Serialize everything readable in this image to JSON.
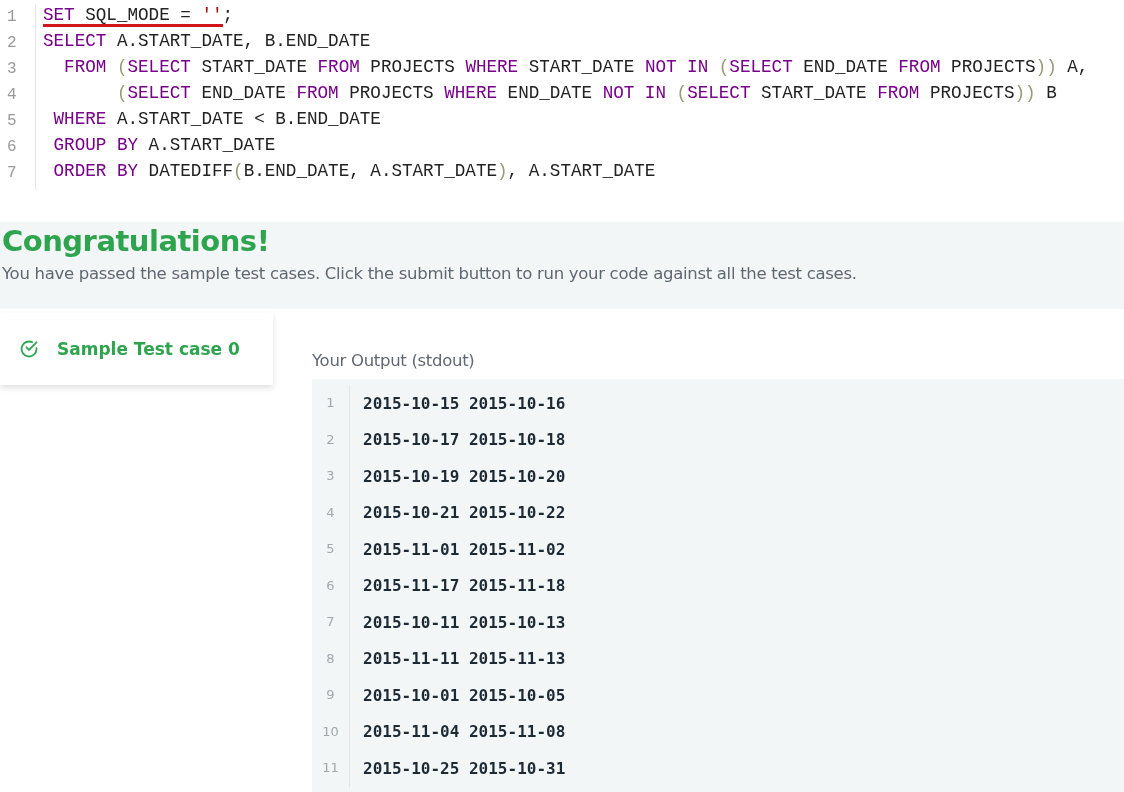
{
  "editor": {
    "lines": [
      {
        "number": "1",
        "tokens": [
          {
            "kind": "keyword",
            "text": "SET",
            "error": true
          },
          {
            "kind": "plain",
            "text": " SQL_MODE = ",
            "error": true
          },
          {
            "kind": "string",
            "text": "''",
            "error": true
          },
          {
            "kind": "plain",
            "text": ";",
            "error": false
          }
        ]
      },
      {
        "number": "2",
        "tokens": [
          {
            "kind": "keyword",
            "text": "SELECT"
          },
          {
            "kind": "plain",
            "text": " A.START_DATE, B.END_DATE"
          }
        ]
      },
      {
        "number": "3",
        "tokens": [
          {
            "kind": "keyword",
            "text": "  FROM"
          },
          {
            "kind": "paren",
            "text": " ("
          },
          {
            "kind": "keyword",
            "text": "SELECT"
          },
          {
            "kind": "plain",
            "text": " START_DATE "
          },
          {
            "kind": "keyword",
            "text": "FROM"
          },
          {
            "kind": "plain",
            "text": " PROJECTS "
          },
          {
            "kind": "keyword",
            "text": "WHERE"
          },
          {
            "kind": "plain",
            "text": " START_DATE "
          },
          {
            "kind": "keyword",
            "text": "NOT IN"
          },
          {
            "kind": "paren",
            "text": " ("
          },
          {
            "kind": "keyword",
            "text": "SELECT"
          },
          {
            "kind": "plain",
            "text": " END_DATE "
          },
          {
            "kind": "keyword",
            "text": "FROM"
          },
          {
            "kind": "plain",
            "text": " PROJECTS"
          },
          {
            "kind": "paren",
            "text": "))"
          },
          {
            "kind": "plain",
            "text": " A,"
          }
        ]
      },
      {
        "number": "4",
        "tokens": [
          {
            "kind": "paren",
            "text": "       ("
          },
          {
            "kind": "keyword",
            "text": "SELECT"
          },
          {
            "kind": "plain",
            "text": " END_DATE "
          },
          {
            "kind": "keyword",
            "text": "FROM"
          },
          {
            "kind": "plain",
            "text": " PROJECTS "
          },
          {
            "kind": "keyword",
            "text": "WHERE"
          },
          {
            "kind": "plain",
            "text": " END_DATE "
          },
          {
            "kind": "keyword",
            "text": "NOT IN"
          },
          {
            "kind": "paren",
            "text": " ("
          },
          {
            "kind": "keyword",
            "text": "SELECT"
          },
          {
            "kind": "plain",
            "text": " START_DATE "
          },
          {
            "kind": "keyword",
            "text": "FROM"
          },
          {
            "kind": "plain",
            "text": " PROJECTS"
          },
          {
            "kind": "paren",
            "text": "))"
          },
          {
            "kind": "plain",
            "text": " B"
          }
        ]
      },
      {
        "number": "5",
        "tokens": [
          {
            "kind": "keyword",
            "text": " WHERE"
          },
          {
            "kind": "plain",
            "text": " A.START_DATE < B.END_DATE"
          }
        ]
      },
      {
        "number": "6",
        "tokens": [
          {
            "kind": "keyword",
            "text": " GROUP BY"
          },
          {
            "kind": "plain",
            "text": " A.START_DATE"
          }
        ]
      },
      {
        "number": "7",
        "tokens": [
          {
            "kind": "keyword",
            "text": " ORDER BY"
          },
          {
            "kind": "plain",
            "text": " DATEDIFF"
          },
          {
            "kind": "paren",
            "text": "("
          },
          {
            "kind": "plain",
            "text": "B.END_DATE, A.START_DATE"
          },
          {
            "kind": "paren",
            "text": ")"
          },
          {
            "kind": "plain",
            "text": ", A.START_DATE"
          }
        ]
      }
    ]
  },
  "result": {
    "title": "Congratulations!",
    "message": "You have passed the sample test cases. Click the submit button to run your code against all the test cases."
  },
  "test_cases": [
    {
      "label": "Sample Test case 0",
      "passed": true,
      "selected": true
    }
  ],
  "output": {
    "title": "Your Output (stdout)",
    "rows": [
      {
        "number": "1",
        "text": "2015-10-15 2015-10-16"
      },
      {
        "number": "2",
        "text": "2015-10-17 2015-10-18"
      },
      {
        "number": "3",
        "text": "2015-10-19 2015-10-20"
      },
      {
        "number": "4",
        "text": "2015-10-21 2015-10-22"
      },
      {
        "number": "5",
        "text": "2015-11-01 2015-11-02"
      },
      {
        "number": "6",
        "text": "2015-11-17 2015-11-18"
      },
      {
        "number": "7",
        "text": "2015-10-11 2015-10-13"
      },
      {
        "number": "8",
        "text": "2015-11-11 2015-11-13"
      },
      {
        "number": "9",
        "text": "2015-10-01 2015-10-05"
      },
      {
        "number": "10",
        "text": "2015-11-04 2015-11-08"
      },
      {
        "number": "11",
        "text": "2015-10-25 2015-10-31"
      }
    ]
  }
}
